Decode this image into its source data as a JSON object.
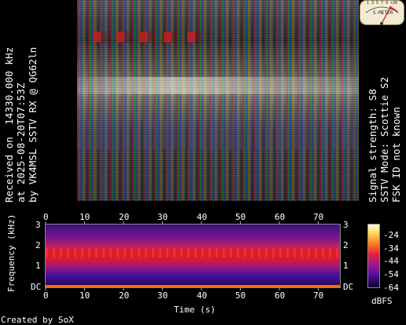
{
  "captions": {
    "left_lines": [
      "Received on  14330.000 kHz",
      "at 2025-08-20T07:53Z",
      "by VK4MSL SSTV RX @ QG62ln"
    ],
    "right_lines": [
      "Signal strength: S8",
      "SSTV Mode: Scottie S2",
      "FSK ID not known"
    ]
  },
  "smeter": {
    "scale_label": "1 3 5 7 9 +20",
    "label": "S-METER"
  },
  "spectrogram": {
    "ylabel": "Frequency (kHz)",
    "xlabel": "Time (s)",
    "x_ticks": [
      "0",
      "10",
      "20",
      "30",
      "40",
      "50",
      "60",
      "70"
    ],
    "y_ticks": [
      "3",
      "2",
      "1",
      "DC"
    ],
    "colorbar_ticks": [
      "-24",
      "-34",
      "-44",
      "-54",
      "-64"
    ],
    "colorbar_unit": "dBFS"
  },
  "footer": {
    "created_by": "Created by SoX"
  },
  "colors": {
    "signal": "#ff2020",
    "dc_line": "#ff6a00",
    "background": "#000000"
  }
}
